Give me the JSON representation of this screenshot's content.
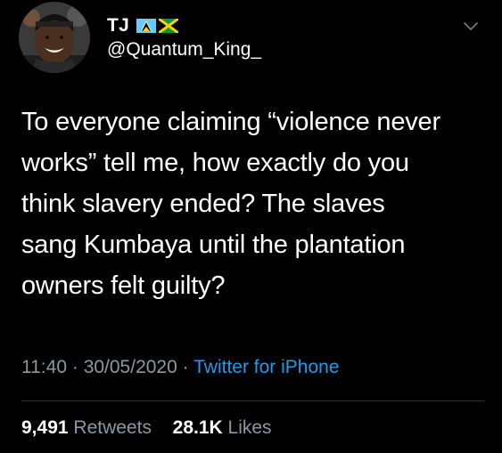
{
  "user": {
    "display_name": "TJ",
    "handle": "@Quantum_King_",
    "flags": [
      "saint-lucia-flag-icon",
      "jamaica-flag-icon"
    ]
  },
  "tweet": {
    "text": "To everyone claiming “violence never\nworks” tell me, how exactly do you\nthink slavery ended? The slaves\nsang  Kumbaya until the plantation\nowners felt guilty?",
    "time": "11:40",
    "date": "30/05/2020",
    "separator": "·",
    "source": "Twitter for iPhone"
  },
  "stats": {
    "retweets_count": "9,491",
    "retweets_label": "Retweets",
    "likes_count": "28.1K",
    "likes_label": "Likes"
  },
  "colors": {
    "background": "#000000",
    "text": "#ffffff",
    "muted": "#8b98a5",
    "link": "#1d9bf0",
    "divider": "#2f3336"
  }
}
